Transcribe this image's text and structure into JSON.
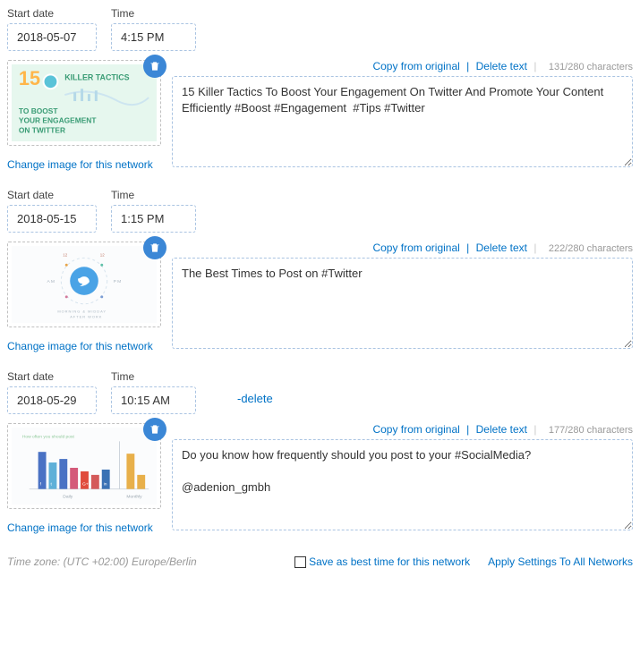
{
  "labels": {
    "start_date": "Start date",
    "time": "Time",
    "change_image": "Change image for this network",
    "copy_from_original": "Copy from original",
    "delete_text": "Delete text",
    "delete_inline": "-delete"
  },
  "posts": [
    {
      "date": "2018-05-07",
      "time": "4:15 PM",
      "char_count": "131/280 characters",
      "text": "15 Killer Tactics To Boost Your Engagement On Twitter And Promote Your Content Efficiently #Boost #Engagement  #Tips #Twitter",
      "show_delete_inline": false
    },
    {
      "date": "2018-05-15",
      "time": "1:15 PM",
      "char_count": "222/280 characters",
      "text": "The Best Times to Post on #Twitter",
      "show_delete_inline": false
    },
    {
      "date": "2018-05-29",
      "time": "10:15 AM",
      "char_count": "177/280 characters",
      "text": "Do you know how frequently should you post to your #SocialMedia?\n\n@adenion_gmbh",
      "show_delete_inline": true
    }
  ],
  "footer": {
    "timezone": "Time zone: (UTC +02:00) Europe/Berlin",
    "save_best_time": "Save as best time for this network",
    "apply_all": "Apply Settings To All Networks"
  }
}
